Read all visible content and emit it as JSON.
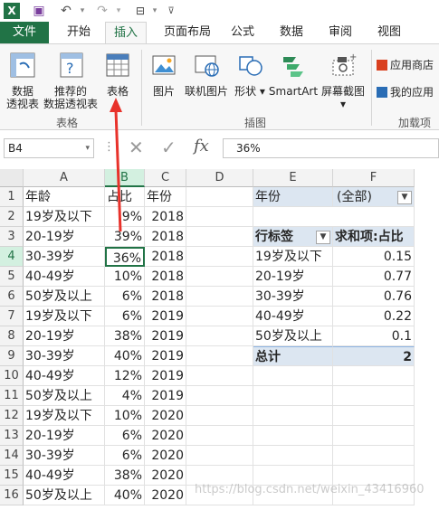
{
  "quick_access": {
    "icons": [
      "excel-logo-icon",
      "save-icon",
      "undo-icon",
      "redo-icon",
      "customize-qat-icon"
    ]
  },
  "tabs": [
    "文件",
    "开始",
    "插入",
    "页面布局",
    "公式",
    "数据",
    "审阅",
    "视图"
  ],
  "active_tab": "插入",
  "ribbon": {
    "pivot_table": "数据\n透视表",
    "pivot_table_l1": "数据",
    "pivot_table_l2": "透视表",
    "recommended_pivot_l1": "推荐的",
    "recommended_pivot_l2": "数据透视表",
    "table": "表格",
    "group_tables": "表格",
    "picture": "图片",
    "online_picture": "联机图片",
    "shapes": "形状",
    "smartart": "SmartArt",
    "screenshot": "屏幕截图",
    "group_illustrations": "插图",
    "app_store": "应用商店",
    "my_apps": "我的应用",
    "group_addins": "加载项"
  },
  "formula_bar": {
    "name_box": "B4",
    "formula": "36%"
  },
  "columns": [
    "A",
    "B",
    "C",
    "D",
    "E",
    "F"
  ],
  "rows": [
    {
      "n": "1",
      "a": "年龄",
      "b": "占比",
      "c": "年份"
    },
    {
      "n": "2",
      "a": "19岁及以下",
      "b": "9%",
      "c": "2018"
    },
    {
      "n": "3",
      "a": "20-19岁",
      "b": "39%",
      "c": "2018"
    },
    {
      "n": "4",
      "a": "30-39岁",
      "b": "36%",
      "c": "2018"
    },
    {
      "n": "5",
      "a": "40-49岁",
      "b": "10%",
      "c": "2018"
    },
    {
      "n": "6",
      "a": "50岁及以上",
      "b": "6%",
      "c": "2018"
    },
    {
      "n": "7",
      "a": "19岁及以下",
      "b": "6%",
      "c": "2019"
    },
    {
      "n": "8",
      "a": "20-19岁",
      "b": "38%",
      "c": "2019"
    },
    {
      "n": "9",
      "a": "30-39岁",
      "b": "40%",
      "c": "2019"
    },
    {
      "n": "10",
      "a": "40-49岁",
      "b": "12%",
      "c": "2019"
    },
    {
      "n": "11",
      "a": "50岁及以上",
      "b": "4%",
      "c": "2019"
    },
    {
      "n": "12",
      "a": "19岁及以下",
      "b": "10%",
      "c": "2020"
    },
    {
      "n": "13",
      "a": "20-19岁",
      "b": "6%",
      "c": "2020"
    },
    {
      "n": "14",
      "a": "30-39岁",
      "b": "6%",
      "c": "2020"
    },
    {
      "n": "15",
      "a": "40-49岁",
      "b": "38%",
      "c": "2020"
    },
    {
      "n": "16",
      "a": "50岁及以上",
      "b": "40%",
      "c": "2020"
    }
  ],
  "pivot": {
    "filter_label": "年份",
    "filter_value": "(全部)",
    "row_label_header": "行标签",
    "value_header": "求和项:占比",
    "items": [
      {
        "label": "19岁及以下",
        "value": "0.15"
      },
      {
        "label": "20-19岁",
        "value": "0.77"
      },
      {
        "label": "30-39岁",
        "value": "0.76"
      },
      {
        "label": "40-49岁",
        "value": "0.22"
      },
      {
        "label": "50岁及以上",
        "value": "0.1"
      }
    ],
    "total_label": "总计",
    "total_value": "2"
  },
  "watermark": "https://blog.csdn.net/weixin_43416960",
  "colors": {
    "excel_green": "#217346",
    "pivot_blue": "#dce6f1",
    "annotation_red": "#e8322b"
  }
}
